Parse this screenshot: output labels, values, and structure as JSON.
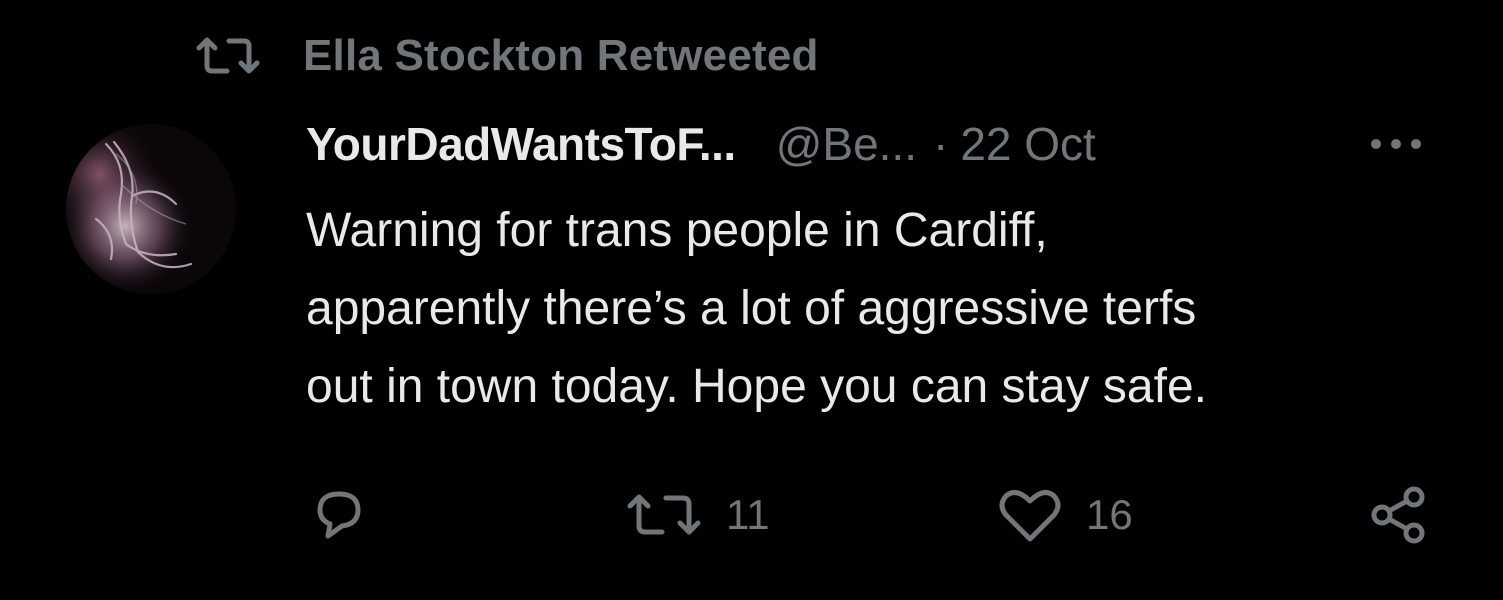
{
  "retweet_context": {
    "icon": "retweet-icon",
    "text": "Ella Stockton Retweeted"
  },
  "author": {
    "display_name": "YourDadWantsToF...",
    "handle": "@Be...",
    "separator": "·",
    "timestamp": "22 Oct",
    "avatar_icon": "avatar"
  },
  "tweet": {
    "lines": [
      "Warning for trans people in Cardiff,",
      "apparently there’s a lot of aggressive terfs",
      "out in town today. Hope you can stay safe."
    ]
  },
  "actions": {
    "reply": {
      "icon": "reply-icon",
      "count": ""
    },
    "retweet": {
      "icon": "retweet-icon",
      "count": "11"
    },
    "like": {
      "icon": "heart-icon",
      "count": "16"
    },
    "share": {
      "icon": "share-icon"
    }
  },
  "more": {
    "icon": "more-horizontal-icon"
  },
  "colors": {
    "background": "#000000",
    "primary_text": "#e7e9ea",
    "secondary_text": "#71767b"
  }
}
